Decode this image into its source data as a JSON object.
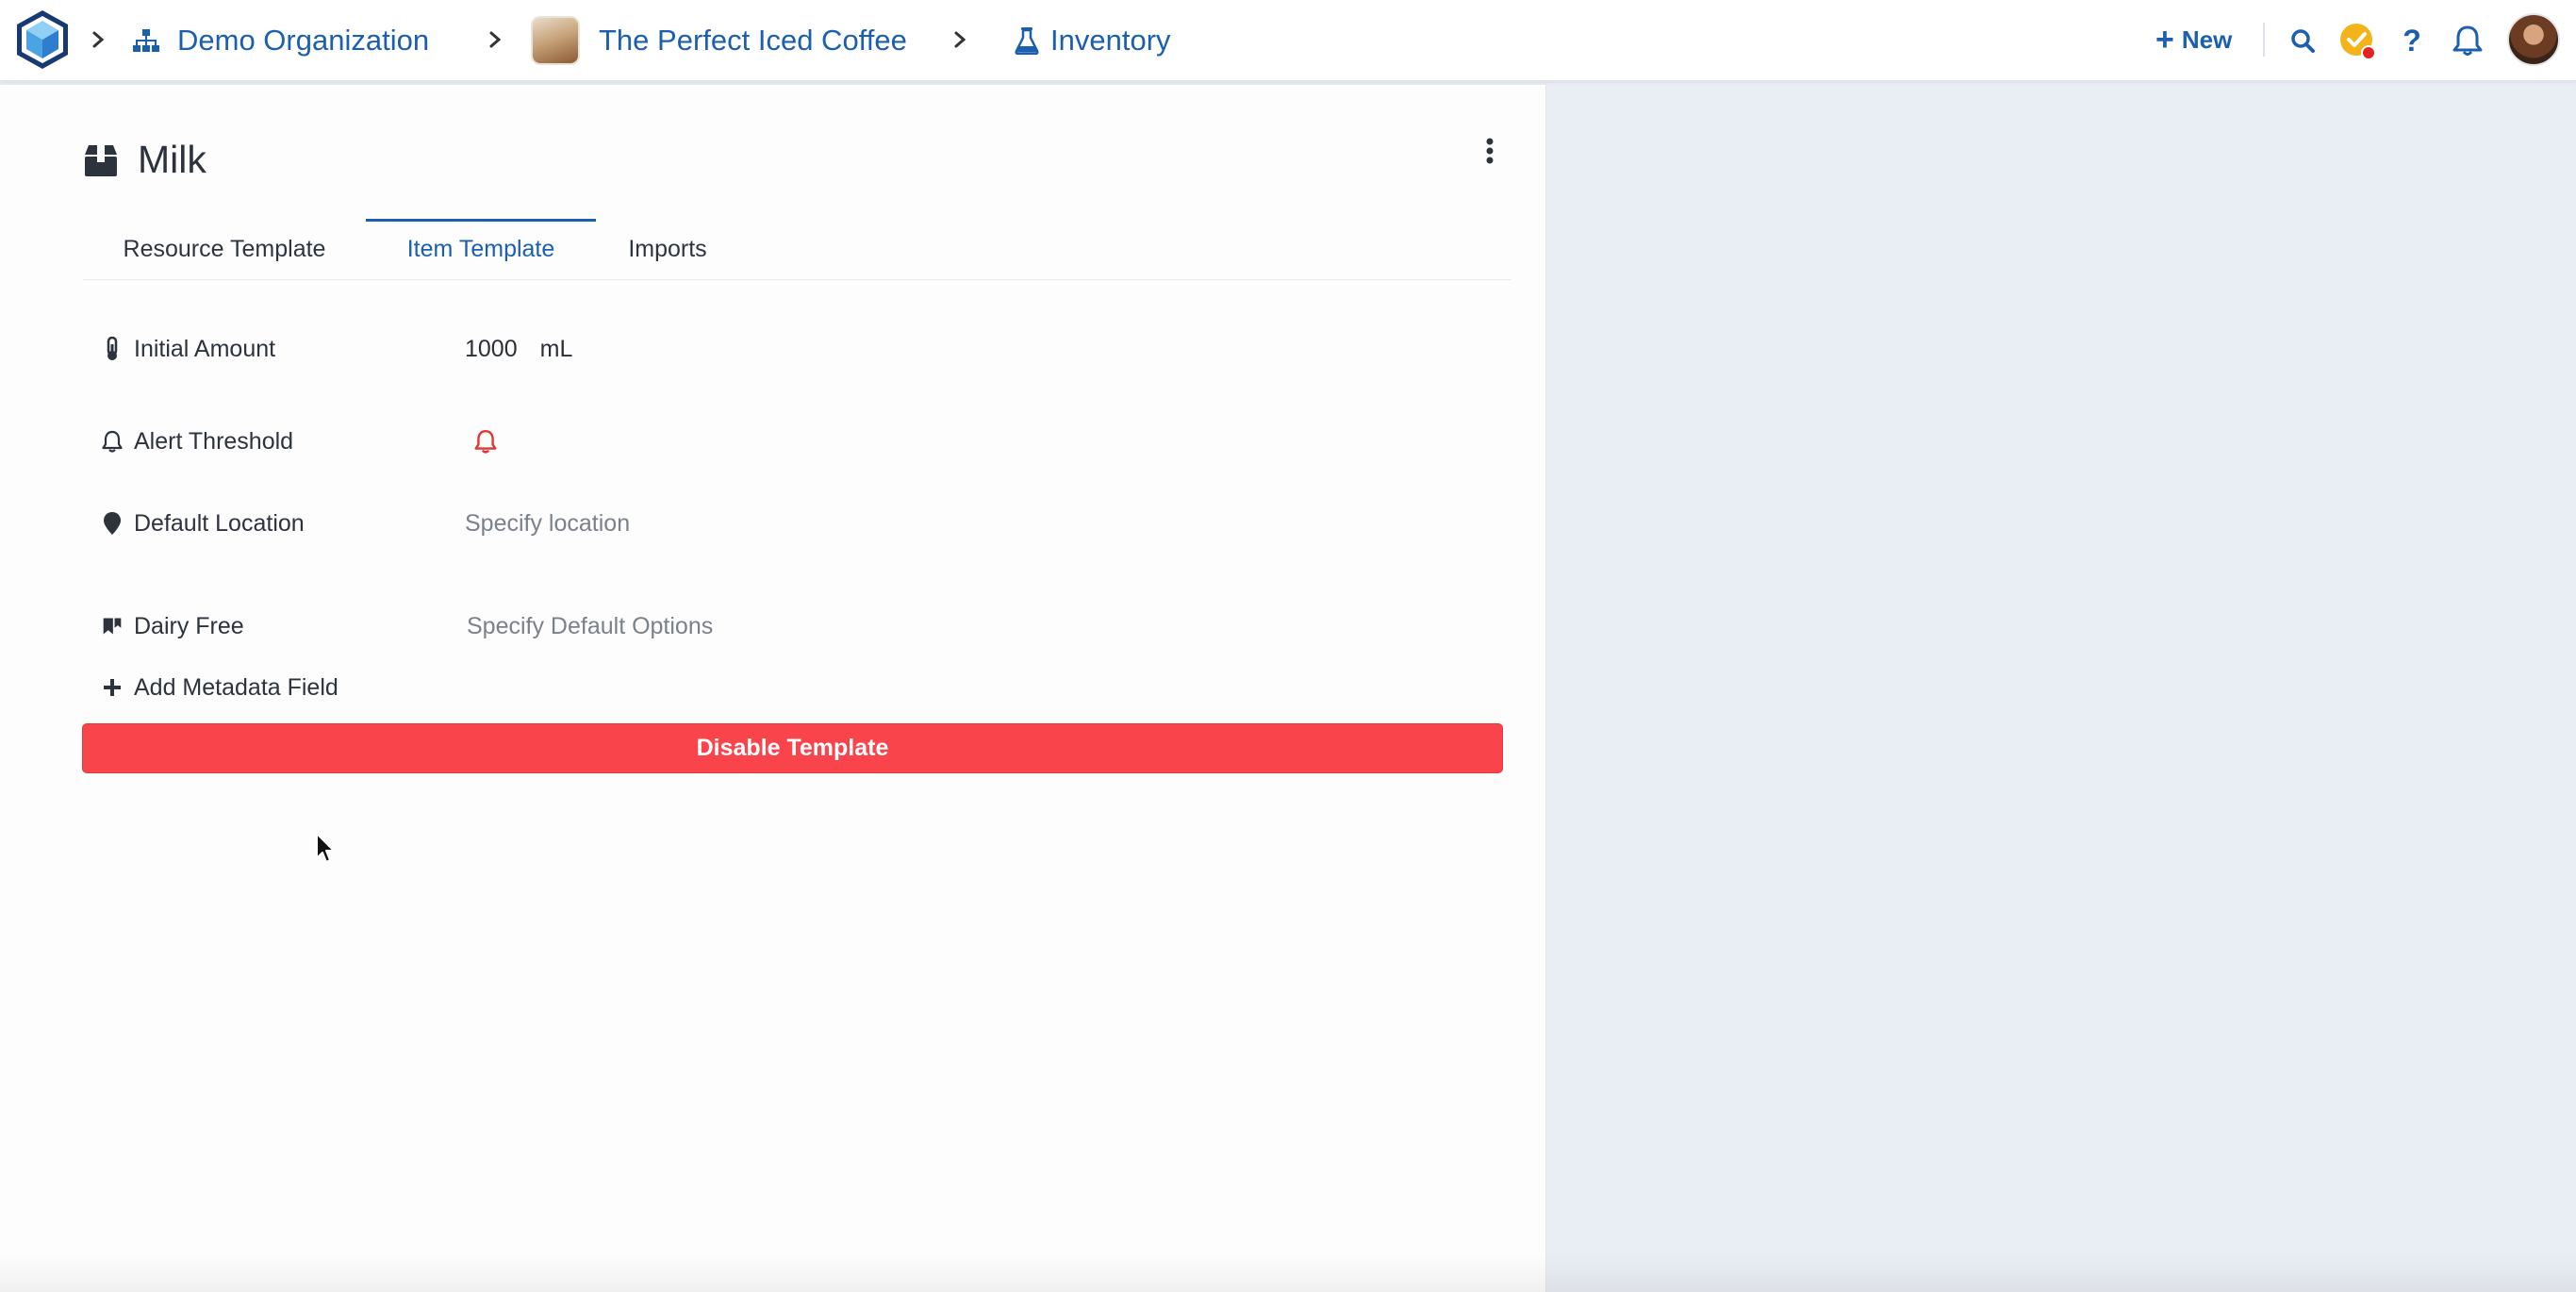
{
  "breadcrumb": {
    "organization": "Demo Organization",
    "project": "The Perfect Iced Coffee",
    "section": "Inventory"
  },
  "topbar": {
    "new_label": "New"
  },
  "resource": {
    "title": "Milk"
  },
  "tabs": [
    {
      "label": "Resource Template",
      "active": false
    },
    {
      "label": "Item Template",
      "active": true
    },
    {
      "label": "Imports",
      "active": false
    }
  ],
  "fields": {
    "initial_amount": {
      "label": "Initial Amount",
      "value": "1000",
      "unit": "mL"
    },
    "alert_threshold": {
      "label": "Alert Threshold"
    },
    "default_location": {
      "label": "Default Location",
      "placeholder": "Specify location"
    },
    "dairy_free": {
      "label": "Dairy Free",
      "placeholder": "Specify Default Options"
    }
  },
  "add_metadata_label": "Add Metadata Field",
  "disable_template_label": "Disable Template",
  "colors": {
    "accent": "#1b5fb0",
    "danger": "#f9444b",
    "status_check": "#f4b31b",
    "status_dot": "#e0241f"
  }
}
